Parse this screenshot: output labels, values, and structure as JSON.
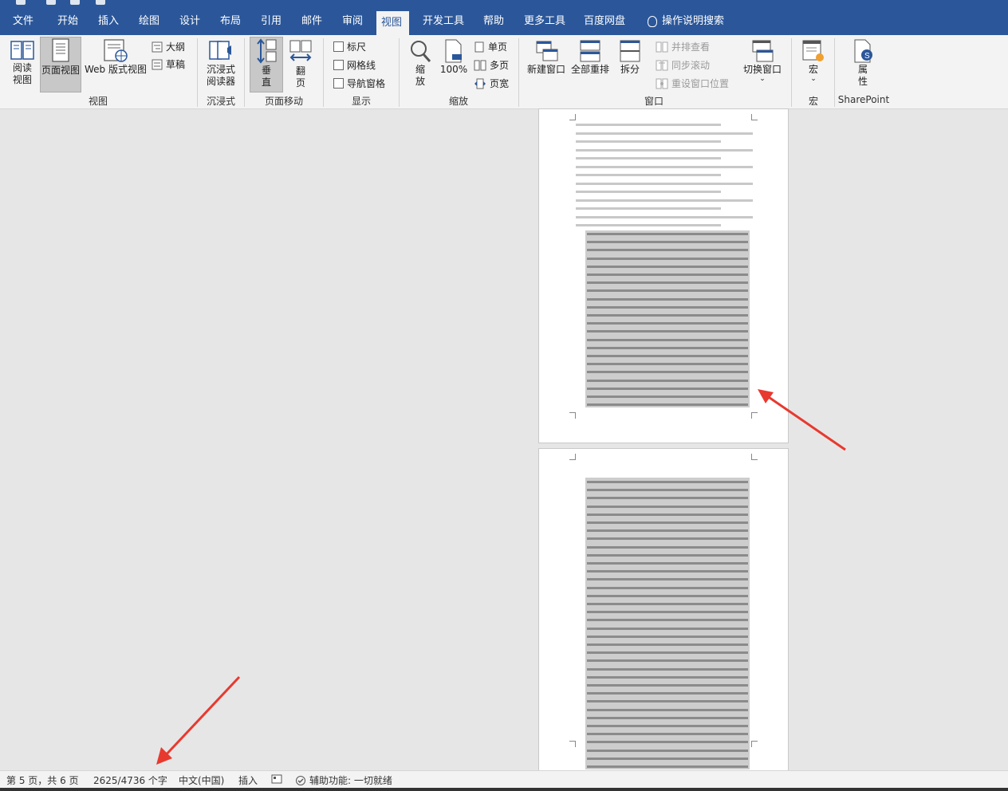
{
  "ribbon_tabs": [
    "文件",
    "开始",
    "插入",
    "绘图",
    "设计",
    "布局",
    "引用",
    "邮件",
    "审阅",
    "视图",
    "开发工具",
    "帮助",
    "更多工具",
    "百度网盘"
  ],
  "active_tab": "视图",
  "tell_me": "操作说明搜索",
  "views": {
    "read_mode": "阅读视图",
    "print_layout": "页面视图",
    "web_layout": "Web 版式视图",
    "outline": "大纲",
    "draft": "草稿",
    "group": "视图"
  },
  "immersive": {
    "reader": "沉浸式阅读器",
    "group": "沉浸式"
  },
  "page_movement": {
    "vertical": "垂直",
    "side_to_side": "翻页",
    "group": "页面移动"
  },
  "show": {
    "ruler": "标尺",
    "gridlines": "网格线",
    "nav_pane": "导航窗格",
    "group": "显示"
  },
  "zoom": {
    "zoom": "缩放",
    "pct": "100%",
    "one_page": "单页",
    "multiple": "多页",
    "page_width": "页宽",
    "group": "缩放"
  },
  "window": {
    "new_window": "新建窗口",
    "arrange_all": "全部重排",
    "split": "拆分",
    "side_by_side": "并排查看",
    "sync_scroll": "同步滚动",
    "reset_pos": "重设窗口位置",
    "switch": "切换窗口",
    "group": "窗口"
  },
  "macros": {
    "label": "宏",
    "group": "宏"
  },
  "sharepoint": {
    "props": "属性",
    "group": "SharePoint"
  },
  "status": {
    "page": "第 5 页，共 6 页",
    "words": "2625/4736 个字",
    "lang": "中文(中国)",
    "mode": "插入",
    "a11y": "辅助功能: 一切就绪"
  },
  "colors": {
    "accent": "#2b579a",
    "arrow": "#e8392f"
  }
}
